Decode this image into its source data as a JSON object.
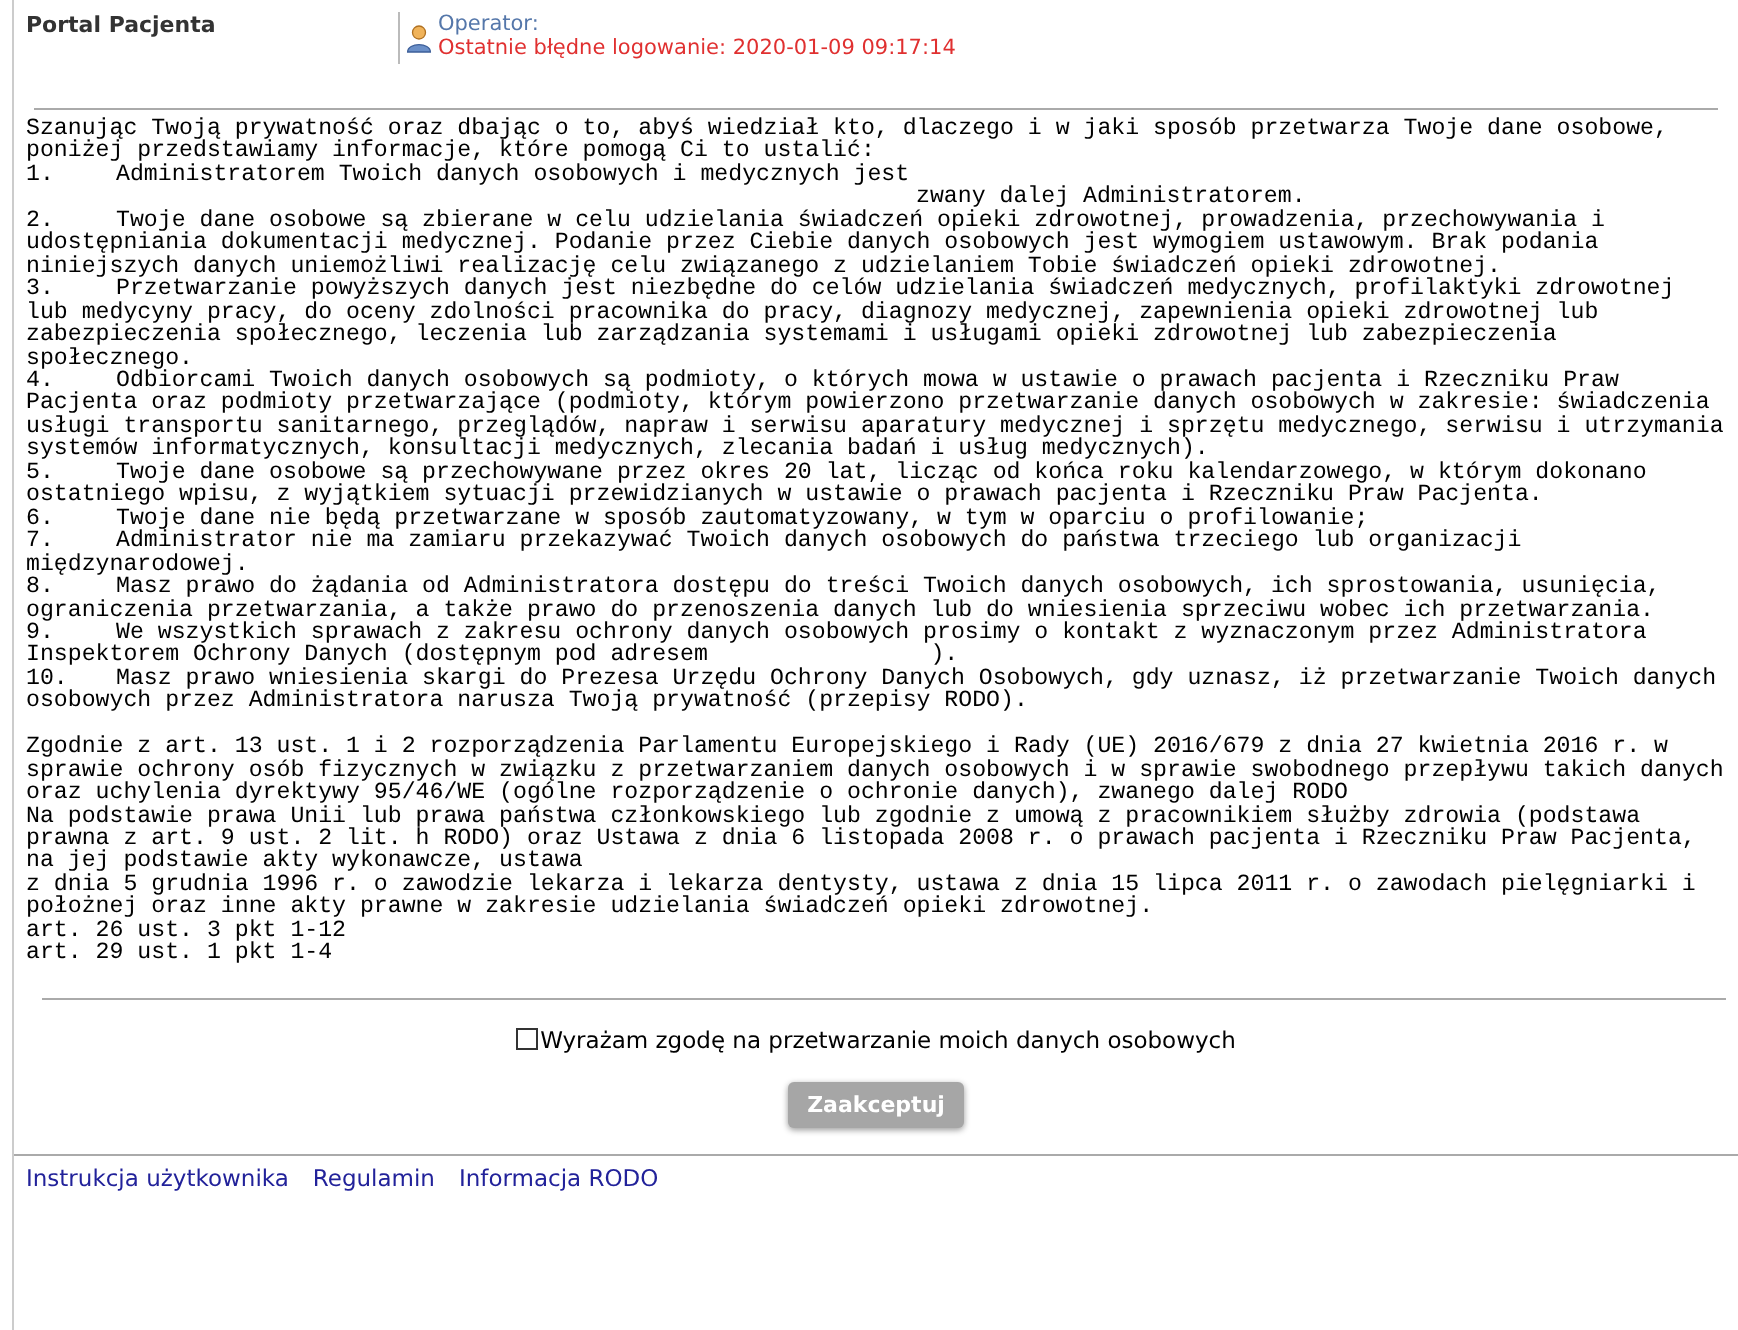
{
  "header": {
    "title": "Portal Pacjenta",
    "operator_label": "Operator:",
    "last_failed_login": "Ostatnie błędne logowanie: 2020-01-09 09:17:14"
  },
  "intro": "Szanując Twoją prywatność oraz dbając o to, abyś wiedział kto, dlaczego i w jaki sposób przetwarza Twoje dane osobowe, poniżej przedstawiamy informacje, które pomogą Ci to ustalić:",
  "items": [
    {
      "number": "1.",
      "text": "Administratorem Twoich danych osobowych i medycznych jest",
      "continuation": "zwany dalej Administratorem."
    },
    {
      "number": "2.",
      "text": "Twoje dane osobowe są zbierane w celu udzielania świadczeń opieki zdrowotnej, prowadzenia, przechowywania i udostępniania dokumentacji medycznej. Podanie przez Ciebie danych osobowych jest wymogiem ustawowym. Brak podania niniejszych danych uniemożliwi realizację celu związanego z udzielaniem Tobie świadczeń opieki zdrowotnej."
    },
    {
      "number": "3.",
      "text": "Przetwarzanie powyższych danych jest niezbędne do celów udzielania świadczeń medycznych, profilaktyki zdrowotnej lub medycyny pracy, do oceny zdolności pracownika do pracy, diagnozy medycznej, zapewnienia opieki zdrowotnej lub zabezpieczenia społecznego, leczenia lub zarządzania systemami i usługami opieki zdrowotnej lub zabezpieczenia społecznego."
    },
    {
      "number": "4.",
      "text": "Odbiorcami Twoich danych osobowych są podmioty, o których mowa w ustawie o prawach pacjenta i Rzeczniku Praw Pacjenta oraz podmioty przetwarzające (podmioty, którym powierzono przetwarzanie danych osobowych w zakresie: świadczenia usługi transportu sanitarnego, przeglądów, napraw i serwisu aparatury medycznej i sprzętu medycznego, serwisu i utrzymania systemów informatycznych, konsultacji medycznych, zlecania badań i usług medycznych)."
    },
    {
      "number": "5.",
      "text": "Twoje dane osobowe są przechowywane przez okres 20 lat, licząc od końca roku kalendarzowego, w którym dokonano ostatniego wpisu, z wyjątkiem sytuacji przewidzianych w ustawie o prawach pacjenta i Rzeczniku Praw Pacjenta."
    },
    {
      "number": "6.",
      "text": "Twoje dane nie będą przetwarzane w sposób zautomatyzowany, w tym w oparciu o profilowanie;"
    },
    {
      "number": "7.",
      "text": "Administrator nie ma zamiaru przekazywać Twoich danych osobowych do państwa trzeciego lub organizacji międzynarodowej."
    },
    {
      "number": "8.",
      "text": "Masz prawo do żądania od Administratora dostępu do treści Twoich danych osobowych, ich sprostowania, usunięcia, ograniczenia przetwarzania, a także prawo do przenoszenia danych lub do wniesienia sprzeciwu wobec ich przetwarzania."
    },
    {
      "number": "9.",
      "text": "We wszystkich sprawach z zakresu ochrony danych osobowych prosimy o kontakt z wyznaczonym przez Administratora Inspektorem Ochrony Danych (dostępnym pod adresem                )."
    },
    {
      "number": "10.",
      "text": "Masz prawo wniesienia skargi do Prezesa Urzędu Ochrony Danych Osobowych, gdy uznasz, iż przetwarzanie Twoich danych osobowych przez Administratora narusza Twoją prywatność (przepisy RODO)."
    }
  ],
  "legal": [
    "Zgodnie z art. 13 ust. 1 i 2 rozporządzenia Parlamentu Europejskiego i Rady (UE) 2016/679 z dnia 27 kwietnia 2016 r. w sprawie ochrony osób fizycznych w związku z przetwarzaniem danych osobowych i w sprawie swobodnego przepływu takich danych oraz uchylenia dyrektywy 95/46/WE (ogólne rozporządzenie o ochronie danych), zwanego dalej RODO",
    "Na podstawie prawa Unii lub prawa państwa członkowskiego lub zgodnie z umową z pracownikiem służby zdrowia (podstawa prawna z art. 9 ust. 2 lit. h RODO) oraz Ustawa z dnia 6 listopada 2008 r. o prawach pacjenta i Rzeczniku Praw Pacjenta, na jej podstawie akty wykonawcze, ustawa",
    "z dnia 5 grudnia 1996 r. o zawodzie lekarza i lekarza dentysty, ustawa z dnia 15 lipca 2011 r. o zawodach pielęgniarki i położnej oraz inne akty prawne w zakresie udzielania świadczeń opieki zdrowotnej.",
    "art. 26 ust. 3 pkt 1-12",
    "art. 29 ust. 1 pkt 1-4"
  ],
  "consent": {
    "label": "Wyrażam zgodę na przetwarzanie moich danych osobowych",
    "checked": false
  },
  "accept_button": {
    "label": "Zaakceptuj",
    "disabled": true
  },
  "footer_links": [
    "Instrukcja użytkownika",
    "Regulamin",
    "Informacja RODO"
  ]
}
